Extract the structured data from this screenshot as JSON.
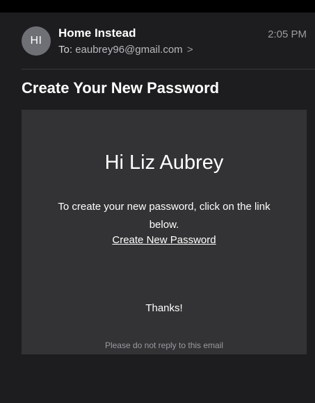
{
  "email": {
    "avatar_initials": "HI",
    "sender_name": "Home Instead",
    "to_label": "To:",
    "to_address": "eaubrey96@gmail.com",
    "to_chevron": ">",
    "time": "2:05 PM",
    "subject": "Create Your New Password"
  },
  "message": {
    "greeting": "Hi Liz Aubrey",
    "body": "To create your new password, click on the link below.",
    "link_text": "Create New Password",
    "thanks": "Thanks!",
    "footer_note": "Please do not reply to this email"
  },
  "colors": {
    "background": "#1d1d1f",
    "card": "#333335",
    "avatar": "#6f7076",
    "muted_text": "#9c9ca1"
  }
}
